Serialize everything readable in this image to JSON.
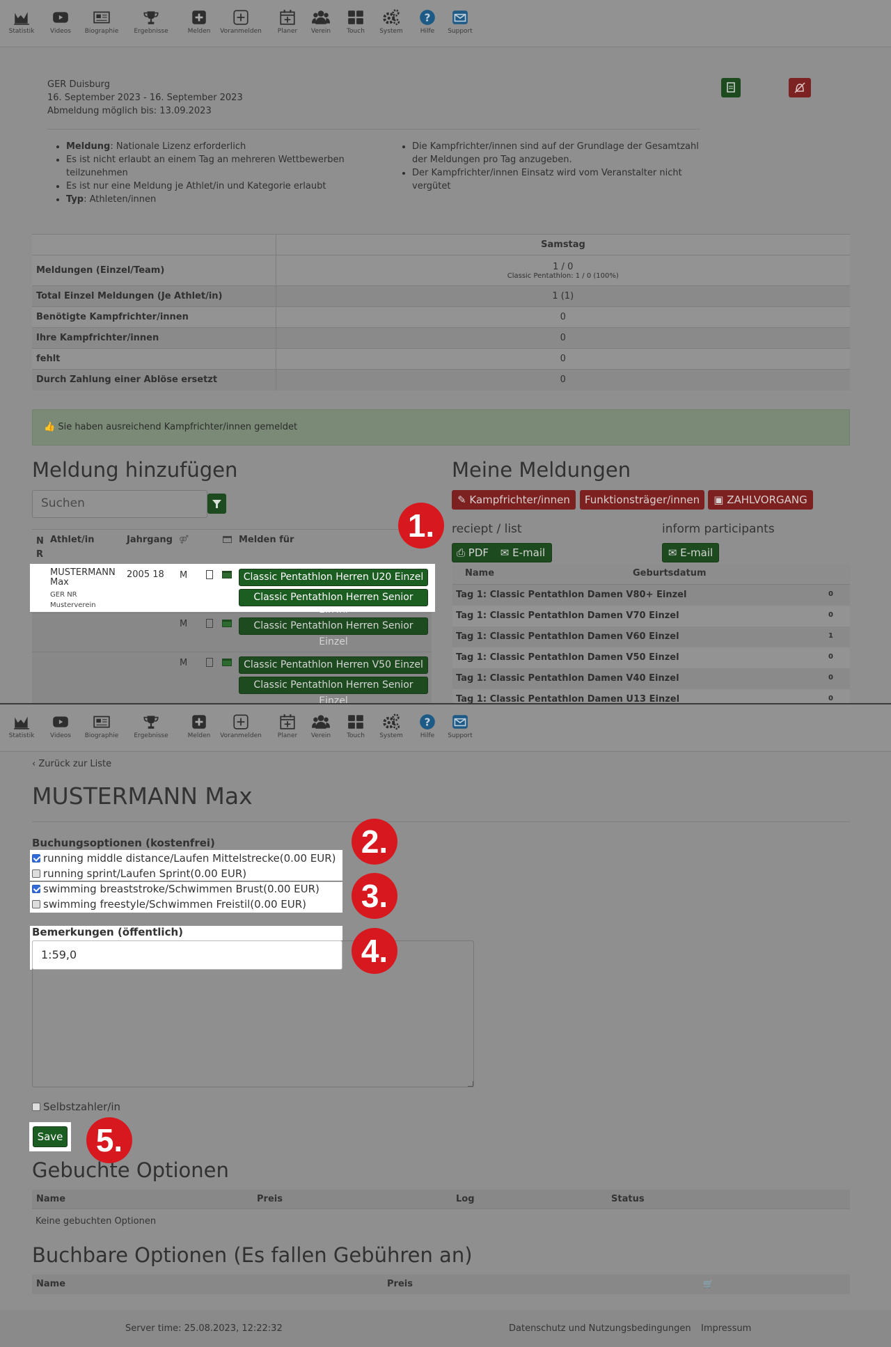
{
  "nav": [
    {
      "label": "Statistik",
      "icon": "chart-icon"
    },
    {
      "label": "Videos",
      "icon": "video-icon"
    },
    {
      "label": "Biographie",
      "icon": "newspaper-icon"
    },
    {
      "label": "Ergebnisse",
      "icon": "trophy-icon"
    },
    {
      "label": "Melden",
      "icon": "plus-square-icon"
    },
    {
      "label": "Voranmelden",
      "icon": "plus-outline-icon"
    },
    {
      "label": "Planer",
      "icon": "calendar-plus-icon"
    },
    {
      "label": "Verein",
      "icon": "users-icon"
    },
    {
      "label": "Touch",
      "icon": "grid-icon"
    },
    {
      "label": "System",
      "icon": "gears-icon"
    },
    {
      "label": "Hilfe",
      "icon": "help-icon"
    },
    {
      "label": "Support",
      "icon": "mail-icon"
    }
  ],
  "event": {
    "location": "GER Duisburg",
    "dates": "16. September 2023 - 16. September 2023",
    "deadline": "Abmeldung möglich bis: 13.09.2023"
  },
  "hints_left": [
    {
      "bold": "Meldung",
      "text": ": Nationale Lizenz erforderlich"
    },
    {
      "bold": "",
      "text": "Es ist nicht erlaubt an einem Tag an mehreren Wettbewerben teilzunehmen"
    },
    {
      "bold": "",
      "text": "Es ist nur eine Meldung je Athlet/in und Kategorie erlaubt"
    },
    {
      "bold": "Typ",
      "text": ": Athleten/innen"
    }
  ],
  "hints_right": [
    "Die Kampfrichter/innen sind auf der Grundlage der Gesamtzahl der Meldungen pro Tag anzugeben.",
    "Der Kampfrichter/innen Einsatz wird vom Veranstalter nicht vergütet"
  ],
  "summary": {
    "day_header": "Samstag",
    "rows": [
      {
        "label": "Meldungen (Einzel/Team)",
        "value": "1 / 0",
        "sub": "Classic Pentathlon: 1 / 0 (100%)"
      },
      {
        "label": "Total Einzel Meldungen (Je Athlet/in)",
        "value": "1 (1)"
      },
      {
        "label": "Benötigte Kampfrichter/innen",
        "value": "0"
      },
      {
        "label": "Ihre Kampfrichter/innen",
        "value": "0"
      },
      {
        "label": "fehlt",
        "value": "0"
      },
      {
        "label": "Durch Zahlung einer Ablöse ersetzt",
        "value": "0"
      }
    ]
  },
  "alert": "Sie haben ausreichend Kampfrichter/innen gemeldet",
  "add": {
    "title": "Meldung hinzufügen",
    "search_placeholder": "Suchen",
    "headers": {
      "nr": "N R",
      "athlete": "Athlet/in",
      "year": "Jahrgang",
      "enter_for": "Melden für"
    },
    "athlete": {
      "name": "MUSTERMANN Max",
      "year": "2005 18",
      "sex": "M",
      "nation": "GER NR",
      "club": "Musterverein"
    },
    "rows": [
      {
        "sex": "M",
        "events": [
          "Classic Pentathlon Herren U20 Einzel",
          "Classic Pentathlon Herren Senior Einzel"
        ]
      },
      {
        "sex": "M",
        "events": [
          "Classic Pentathlon Herren Senior Einzel"
        ]
      },
      {
        "sex": "M",
        "events": [
          "Classic Pentathlon Herren V50 Einzel",
          "Classic Pentathlon Herren Senior Einzel"
        ]
      }
    ]
  },
  "mine": {
    "title": "Meine Meldungen",
    "btn_judges": "Kampfrichter/innen",
    "btn_officials": "Funktionsträger/innen",
    "btn_payment": "ZAHLVORGANG",
    "receipt_label": "reciept / list",
    "inform_label": "inform participants",
    "btn_pdf": "PDF",
    "btn_email": "E-mail",
    "btn_email2": "E-mail",
    "col_name": "Name",
    "col_birth": "Geburtsdatum",
    "rows": [
      {
        "name": "Tag 1: Classic Pentathlon Damen V80+ Einzel",
        "count": "0"
      },
      {
        "name": "Tag 1: Classic Pentathlon Damen V70 Einzel",
        "count": "0"
      },
      {
        "name": "Tag 1: Classic Pentathlon Damen V60 Einzel",
        "count": "1"
      },
      {
        "name": "Tag 1: Classic Pentathlon Damen V50 Einzel",
        "count": "0"
      },
      {
        "name": "Tag 1: Classic Pentathlon Damen V40 Einzel",
        "count": "0"
      },
      {
        "name": "Tag 1: Classic Pentathlon Damen U13 Einzel",
        "count": "0"
      }
    ]
  },
  "badges": [
    "1.",
    "2.",
    "3.",
    "4.",
    "5."
  ],
  "detail": {
    "back": "Zurück zur Liste",
    "name": "MUSTERMANN Max",
    "options_title": "Buchungsoptionen (kostenfrei)",
    "options": [
      {
        "label": "running middle distance/Laufen Mittelstrecke(0.00 EUR)",
        "checked": true
      },
      {
        "label": "running sprint/Laufen Sprint(0.00 EUR)",
        "checked": false
      },
      {
        "label": "swimming breaststroke/Schwimmen Brust(0.00 EUR)",
        "checked": true
      },
      {
        "label": "swimming freestyle/Schwimmen Freistil(0.00 EUR)",
        "checked": false
      }
    ],
    "remarks_label": "Bemerkungen (öffentlich)",
    "remarks_value": "1:59,0",
    "self_payer": "Selbstzahler/in",
    "save": "Save",
    "booked_title": "Gebuchte Optionen",
    "booked_headers": [
      "Name",
      "Preis",
      "Log",
      "Status"
    ],
    "booked_empty": "Keine gebuchten Optionen",
    "bookable_title": "Buchbare Optionen (Es fallen Gebühren an)",
    "bookable_headers": [
      "Name",
      "Preis"
    ],
    "footer_time": "Server time: 25.08.2023, 12:22:32",
    "footer_privacy": "Datenschutz und Nutzungsbedingungen",
    "footer_imprint": "Impressum"
  }
}
